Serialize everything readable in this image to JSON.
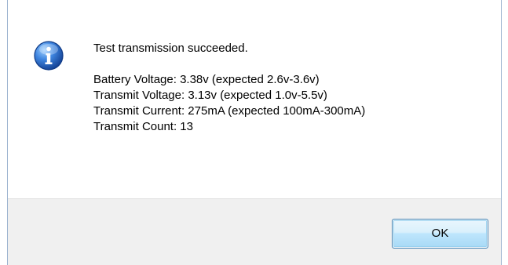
{
  "dialog": {
    "icon": "information-icon",
    "message": {
      "title": "Test transmission succeeded.",
      "lines": [
        "Battery Voltage: 3.38v (expected 2.6v-3.6v)",
        "Transmit Voltage: 3.13v (expected 1.0v-5.5v)",
        "Transmit Current: 275mA (expected 100mA-300mA)",
        "Transmit Count: 13"
      ]
    },
    "buttons": {
      "ok_label": "OK"
    }
  },
  "colors": {
    "frame": "#9cb3cf",
    "footer_background": "#f0f0f0",
    "icon_blue": "#1f5fbf",
    "button_border": "#3c7fb1"
  }
}
